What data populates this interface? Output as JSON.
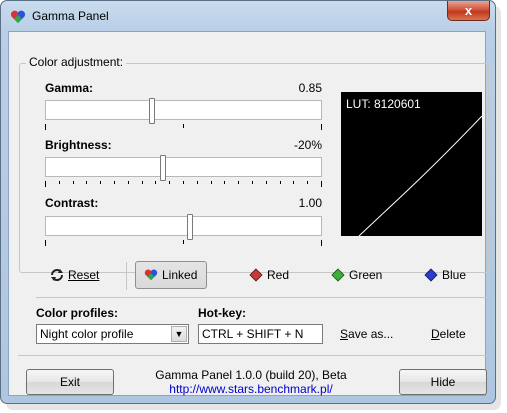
{
  "window": {
    "title": "Gamma Panel",
    "close_glyph": "x"
  },
  "adjust": {
    "group_label": "Color adjustment:",
    "gamma": {
      "label": "Gamma:",
      "value": "0.85",
      "level": 0.38
    },
    "brightness": {
      "label": "Brightness:",
      "value": "-20%",
      "level": 0.42
    },
    "contrast": {
      "label": "Contrast:",
      "value": "1.00",
      "level": 0.52
    },
    "lut_label": "LUT: 8120601"
  },
  "toolbar": {
    "reset": "Reset",
    "linked": "Linked",
    "red": "Red",
    "green": "Green",
    "blue": "Blue"
  },
  "profiles": {
    "label": "Color profiles:",
    "selected": "Night color profile"
  },
  "hotkey": {
    "label": "Hot-key:",
    "value": "CTRL + SHIFT + N",
    "save_as": "Save as...",
    "delete": "Delete"
  },
  "footer": {
    "exit": "Exit",
    "hide": "Hide",
    "version": "Gamma Panel 1.0.0 (build 20), Beta",
    "link": "http://www.stars.benchmark.pl/"
  },
  "colors": {
    "red_icon": "#c83a3a",
    "green_icon": "#3cae3c",
    "blue_icon": "#2a3ec9",
    "link": "#0000cc"
  },
  "icons": {
    "app": "heart-icon",
    "reset": "reset-arrows-icon",
    "red": "red-diamond-icon",
    "green": "green-diamond-icon",
    "blue": "blue-diamond-icon"
  }
}
